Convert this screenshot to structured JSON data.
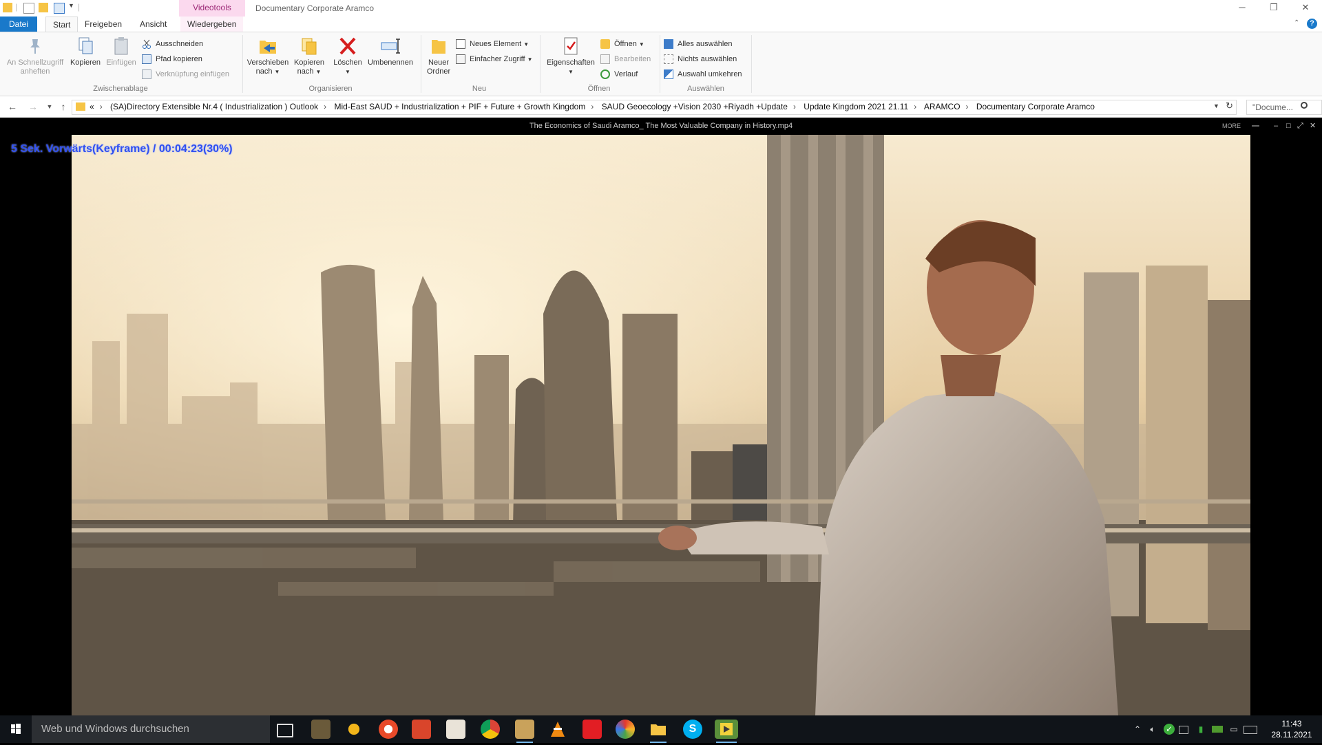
{
  "window": {
    "context_tab": "Videotools",
    "title": "Documentary Corporate Aramco"
  },
  "ribbon_tabs": [
    "Datei",
    "Start",
    "Freigeben",
    "Ansicht",
    "Wiedergeben"
  ],
  "ribbon": {
    "clipboard": {
      "pin_label_1": "An Schnellzugriff",
      "pin_label_2": "anheften",
      "copy_label": "Kopieren",
      "paste_label": "Einfügen",
      "cut_label": "Ausschneiden",
      "copy_path_label": "Pfad kopieren",
      "paste_shortcut_label": "Verknüpfung einfügen",
      "group_label": "Zwischenablage"
    },
    "organize": {
      "move_label_1": "Verschieben",
      "move_label_2": "nach",
      "copyto_label_1": "Kopieren",
      "copyto_label_2": "nach",
      "delete_label": "Löschen",
      "rename_label": "Umbenennen",
      "group_label": "Organisieren"
    },
    "new": {
      "new_folder_label_1": "Neuer",
      "new_folder_label_2": "Ordner",
      "new_item_label": "Neues Element",
      "easy_access_label": "Einfacher Zugriff",
      "group_label": "Neu"
    },
    "open": {
      "properties_label": "Eigenschaften",
      "open_label": "Öffnen",
      "edit_label": "Bearbeiten",
      "history_label": "Verlauf",
      "group_label": "Öffnen"
    },
    "select": {
      "select_all_label": "Alles auswählen",
      "select_none_label": "Nichts auswählen",
      "invert_label": "Auswahl umkehren",
      "group_label": "Auswählen"
    }
  },
  "address": {
    "overflow": "«",
    "crumbs": [
      "(SA)Directory Extensible Nr.4 ( Industrialization )  Outlook",
      "Mid-East SAUD + Industrialization + PIF + Future + Growth Kingdom",
      "SAUD Geoecology +Vision 2030 +Riyadh +Update",
      "Update Kingdom 2021 21.11",
      "ARAMCO",
      "Documentary Corporate Aramco"
    ],
    "search_placeholder": "\"Docume..."
  },
  "player": {
    "file_title": "The Economics of Saudi Aramco_ The Most Valuable Company in History.mp4",
    "more_label": "MORE",
    "osd_text": "5  Sek. Vorwärts(Keyframe) / 00:04:23(30%)"
  },
  "taskbar": {
    "search_placeholder": "Web und Windows durchsuchen",
    "time": "11:43",
    "date": "28.11.2021"
  },
  "colors": {
    "accent": "#1979ca",
    "context_tab": "#9c2776",
    "osd": "#3050f0",
    "taskbar": "#101419"
  }
}
